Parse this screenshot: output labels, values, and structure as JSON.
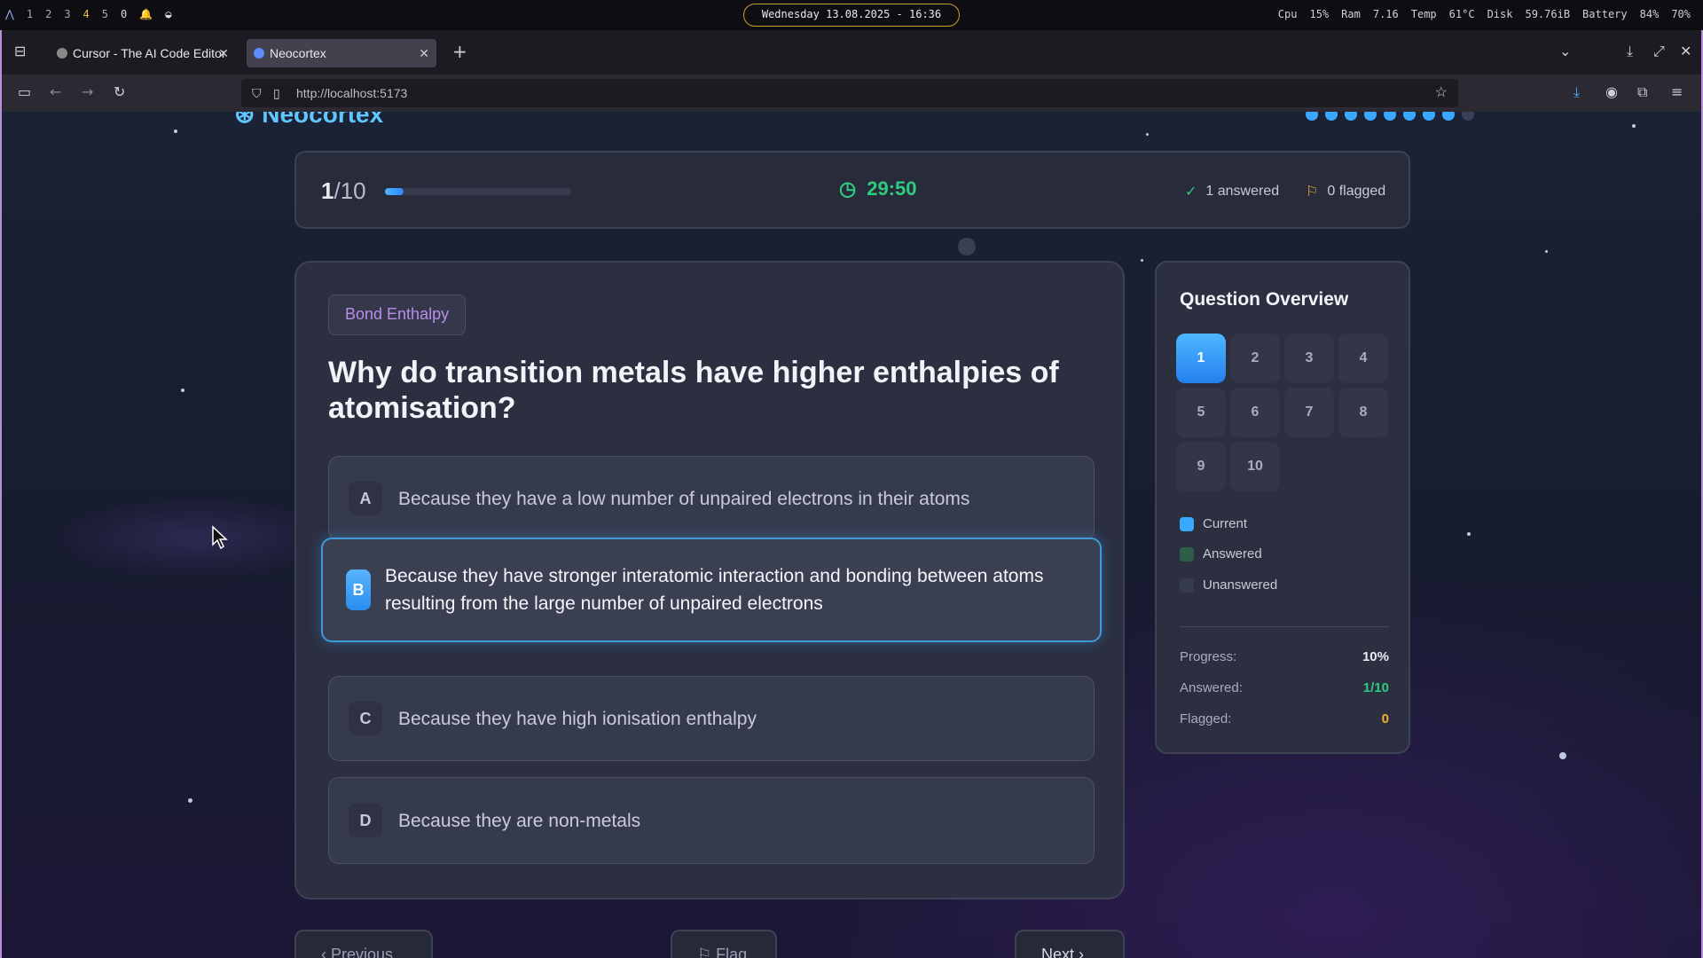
{
  "system_bar": {
    "workspaces": [
      "1",
      "2",
      "3",
      "4",
      "5"
    ],
    "notifications": "0",
    "clock": "Wednesday 13.08.2025 - 16:36",
    "cpu_label": "Cpu",
    "cpu_value": "15%",
    "ram_label": "Ram",
    "ram_value": "7.16",
    "temp_label": "Temp",
    "temp_value": "61°C",
    "disk_label": "Disk",
    "disk_value": "59.76iB",
    "battery_label": "Battery",
    "battery_value": "84%",
    "volume_value": "70%"
  },
  "browser": {
    "tabs": [
      {
        "label": "Cursor - The AI Code Editor",
        "active": false
      },
      {
        "label": "Neocortex",
        "active": true
      }
    ],
    "url": "http://localhost:5173"
  },
  "app": {
    "brand": "Neocortex",
    "question_index": "1",
    "question_total": "/10",
    "progress_fraction": 0.1,
    "timer": "29:50",
    "answered_text": "1 answered",
    "flagged_text": "0 flagged",
    "topic": "Bond Enthalpy",
    "question": "Why do transition metals have higher enthalpies of atomisation?",
    "options": [
      {
        "letter": "A",
        "text": "Because they have a low number of unpaired electrons in their atoms"
      },
      {
        "letter": "B",
        "text": "Because they have stronger interatomic interaction and bonding between atoms resulting from the large number of unpaired electrons"
      },
      {
        "letter": "C",
        "text": "Because they have high ionisation enthalpy"
      },
      {
        "letter": "D",
        "text": "Because they are non-metals"
      }
    ],
    "selected_option": "B",
    "nav": {
      "previous": "Previous",
      "flag": "Flag",
      "next": "Next"
    }
  },
  "overview": {
    "title": "Question Overview",
    "cells": [
      "1",
      "2",
      "3",
      "4",
      "5",
      "6",
      "7",
      "8",
      "9",
      "10"
    ],
    "current": "1",
    "legend": {
      "current": "Current",
      "answered": "Answered",
      "unanswered": "Unanswered"
    },
    "stats": {
      "progress_label": "Progress:",
      "progress_value": "10%",
      "answered_label": "Answered:",
      "answered_value": "1/10",
      "flagged_label": "Flagged:",
      "flagged_value": "0"
    }
  },
  "colors": {
    "accent": "#3aa8ff",
    "timer": "#2ecc80",
    "topic": "#b98ee8",
    "answered_value": "#2ecc80",
    "flagged_value": "#f0b030"
  }
}
